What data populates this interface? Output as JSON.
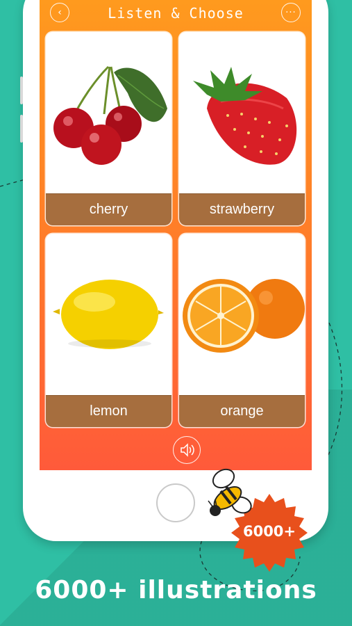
{
  "header": {
    "title": "Listen & Choose",
    "back_icon": "chevron-left-icon",
    "more_icon": "more-horizontal-icon"
  },
  "cards": [
    {
      "label": "cherry"
    },
    {
      "label": "strawberry"
    },
    {
      "label": "lemon"
    },
    {
      "label": "orange"
    }
  ],
  "controls": {
    "speaker_icon": "speaker-icon"
  },
  "badge": {
    "text": "6000+",
    "color": "#e8501c"
  },
  "caption": "6000+ illustrations",
  "colors": {
    "background": "#2fbfa4",
    "screen_top": "#ff9a1e",
    "screen_bottom": "#ff5a3a",
    "label_bg": "#a66e3e"
  }
}
